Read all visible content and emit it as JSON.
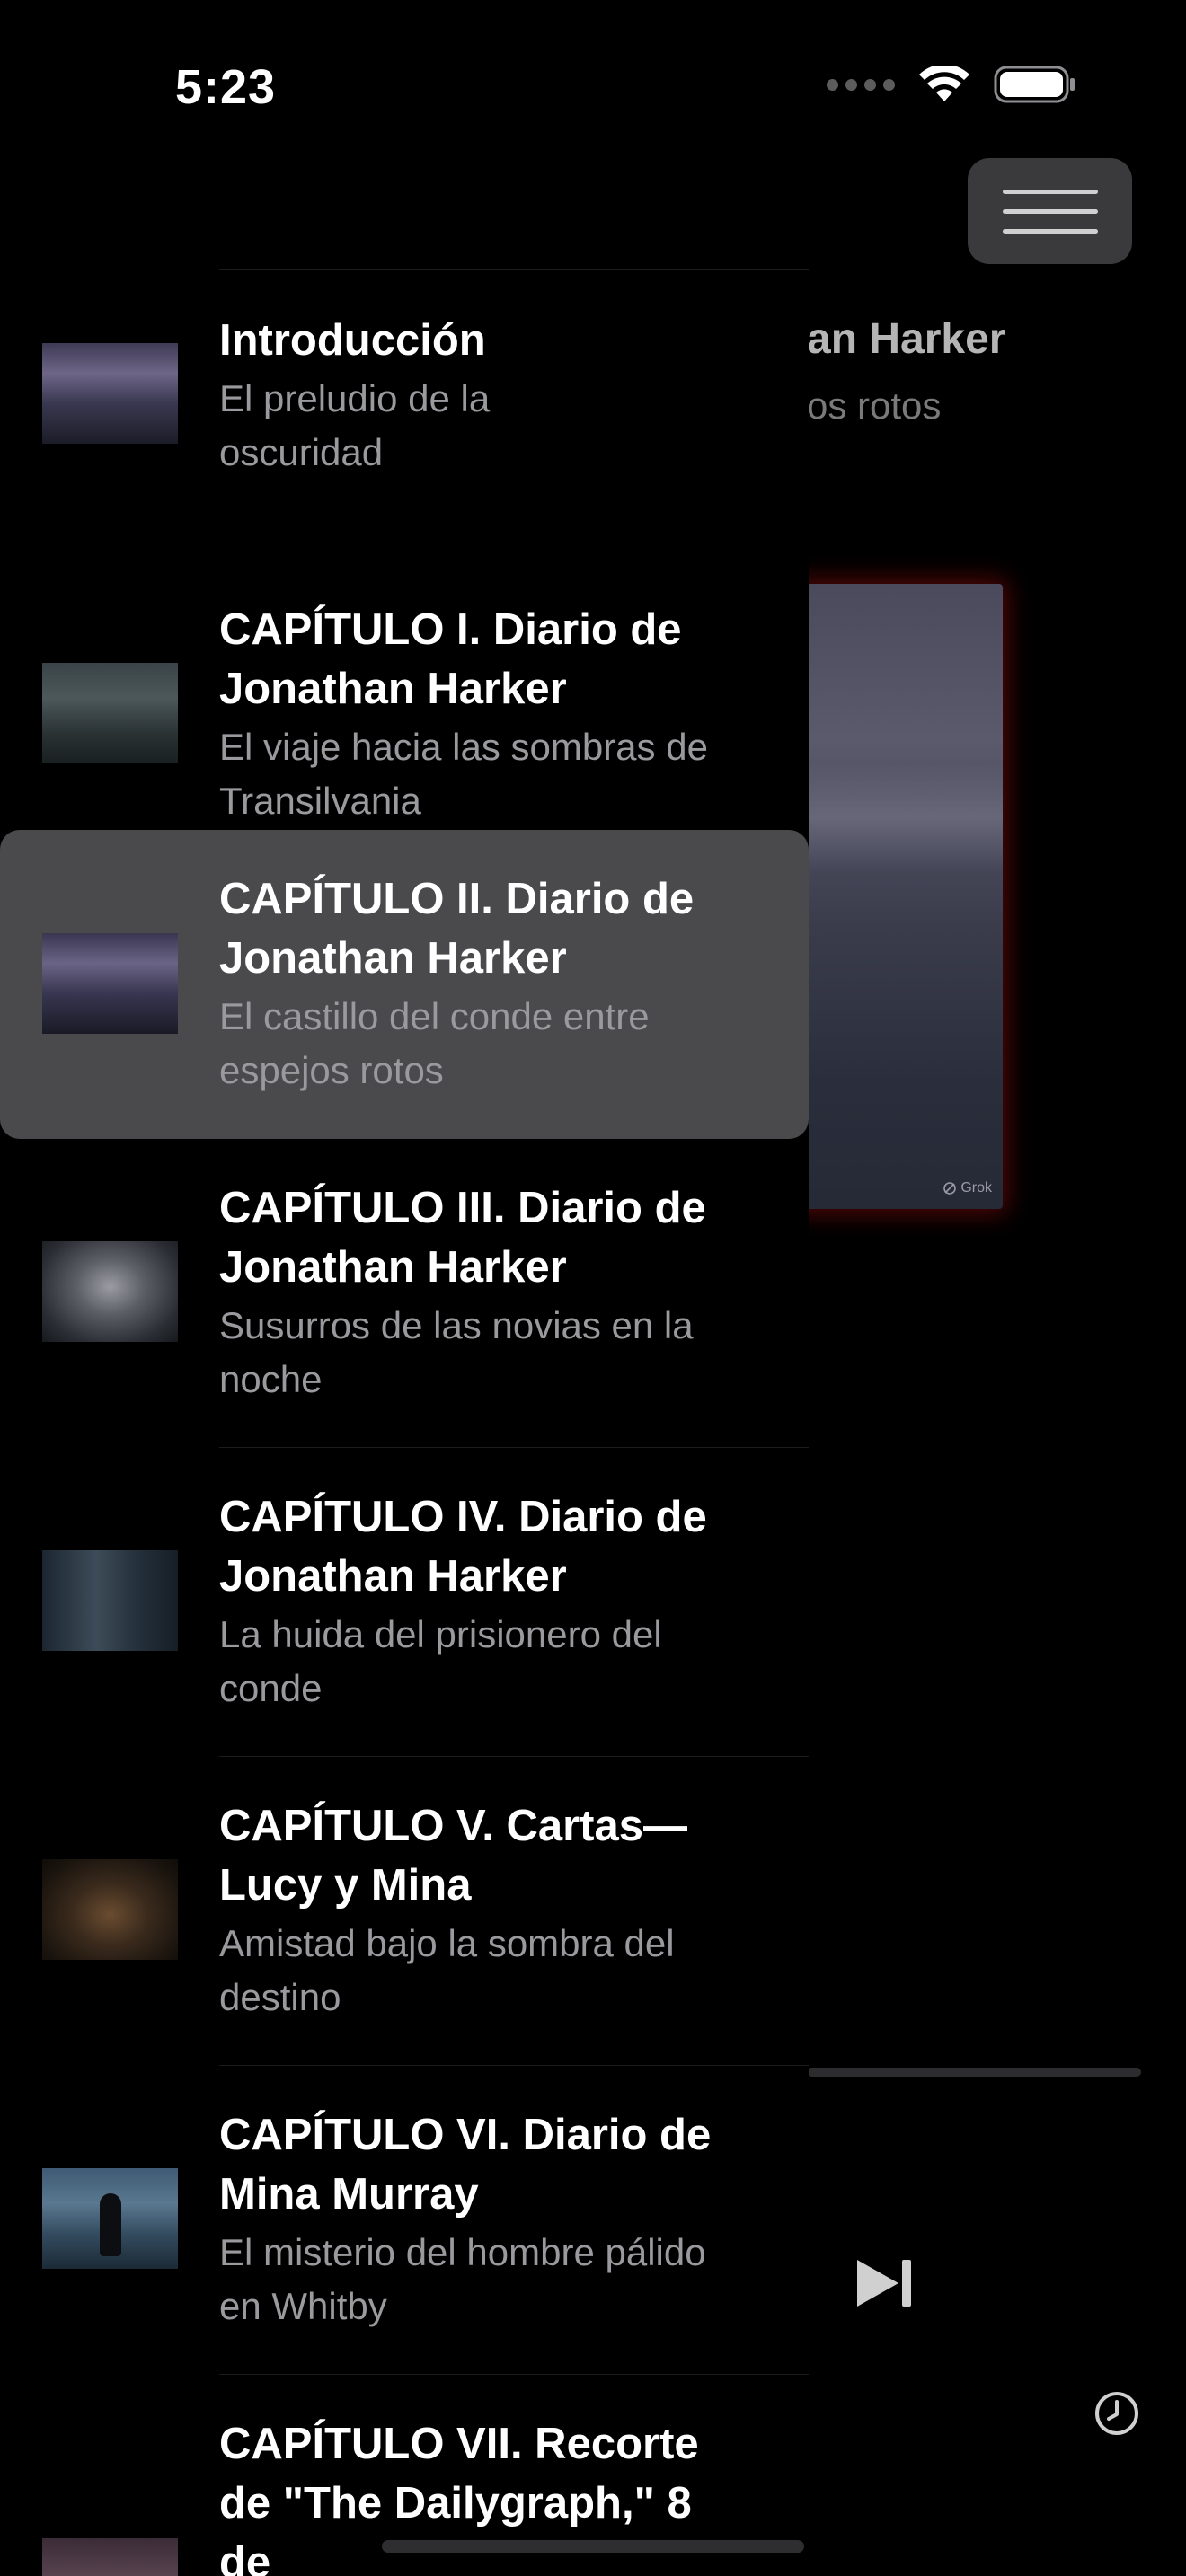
{
  "status_bar": {
    "time": "5:23"
  },
  "background": {
    "title": "an Harker",
    "subtitle": "os rotos",
    "cover_watermark": "Grok"
  },
  "icons": {
    "menu": "hamburger-icon",
    "wifi": "wifi-icon",
    "battery": "battery-icon",
    "signal": "signal-icon",
    "next": "skip-forward-icon",
    "history": "clock-icon"
  },
  "chapters": [
    {
      "title": "Introducción",
      "subtitle": "El preludio de la oscuridad",
      "selected": false
    },
    {
      "title": "CAPÍTULO I. Diario de Jonathan Harker",
      "subtitle": "El viaje hacia las sombras de Transilvania",
      "selected": false
    },
    {
      "title": "CAPÍTULO II. Diario de Jonathan Harker",
      "subtitle": "El castillo del conde entre espejos rotos",
      "selected": true
    },
    {
      "title": "CAPÍTULO III. Diario de Jonathan Harker",
      "subtitle": "Susurros de las novias en la noche",
      "selected": false
    },
    {
      "title": "CAPÍTULO IV. Diario de Jonathan Harker",
      "subtitle": "La huida del prisionero del conde",
      "selected": false
    },
    {
      "title": "CAPÍTULO V. Cartas—Lucy y Mina",
      "subtitle": "Amistad bajo la sombra del destino",
      "selected": false
    },
    {
      "title": "CAPÍTULO VI. Diario de Mina Murray",
      "subtitle": "El misterio del hombre pálido en Whitby",
      "selected": false
    },
    {
      "title": "CAPÍTULO VII. Recorte de \"The Dailygraph,\" 8 de",
      "subtitle": "",
      "selected": false
    }
  ],
  "colors": {
    "background": "#000000",
    "selected_row": "#4a4a4c",
    "menu_button": "#3a3a3c",
    "subtitle_text": "#9a9a9e",
    "cover_glow": "#820c0c"
  }
}
